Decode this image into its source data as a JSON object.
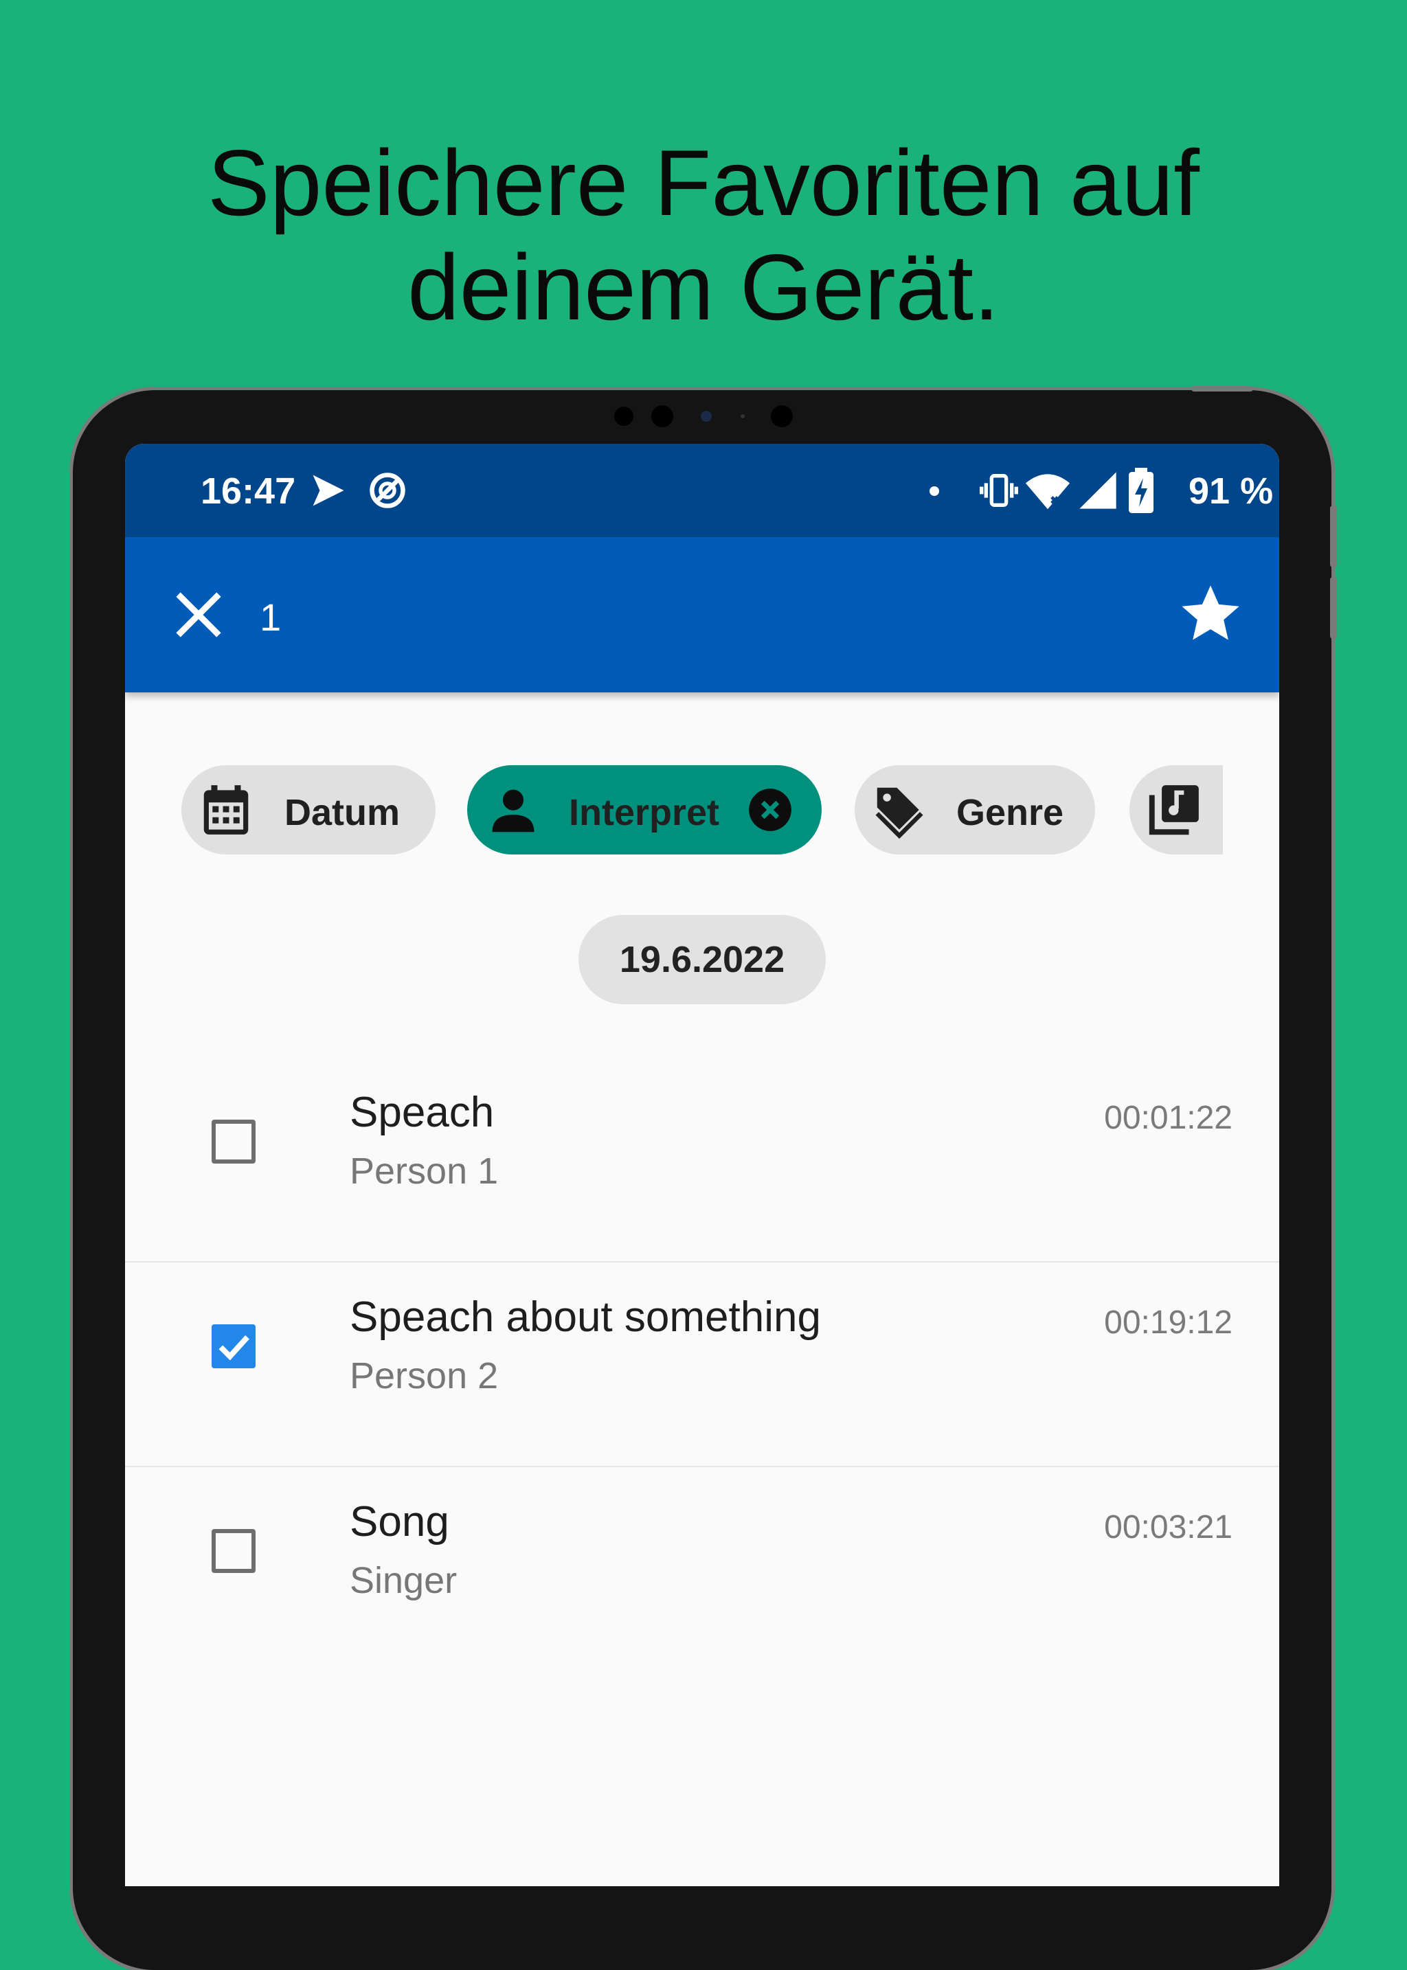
{
  "headline": {
    "line1": "Speichere Favoriten auf",
    "line2": "deinem Gerät."
  },
  "statusbar": {
    "time": "16:47",
    "battery": "91 %",
    "icons": [
      "play-store-icon",
      "sync-off-icon",
      "dot-icon",
      "vibrate-icon",
      "wifi-icon",
      "cell-signal-icon",
      "battery-charging-icon"
    ]
  },
  "appbar": {
    "selected_count": "1",
    "icons": [
      "close-icon",
      "star-icon"
    ]
  },
  "filters": [
    {
      "label": "Datum",
      "icon": "calendar-icon",
      "active": false
    },
    {
      "label": "Interpret",
      "icon": "person-icon",
      "active": true
    },
    {
      "label": "Genre",
      "icon": "tag-icon",
      "active": false
    },
    {
      "label": "",
      "icon": "music-library-icon",
      "active": false
    }
  ],
  "date_header": "19.6.2022",
  "items": [
    {
      "title": "Speach",
      "subtitle": "Person 1",
      "duration": "00:01:22",
      "checked": false
    },
    {
      "title": "Speach about something",
      "subtitle": "Person 2",
      "duration": "00:19:12",
      "checked": true
    },
    {
      "title": "Song",
      "subtitle": "Singer",
      "duration": "00:03:21",
      "checked": false
    }
  ],
  "colors": {
    "background": "#1ab17a",
    "statusbar": "#01468a",
    "appbar": "#005cb8",
    "active_chip": "#00917e",
    "checkbox_checked": "#2287e8"
  }
}
